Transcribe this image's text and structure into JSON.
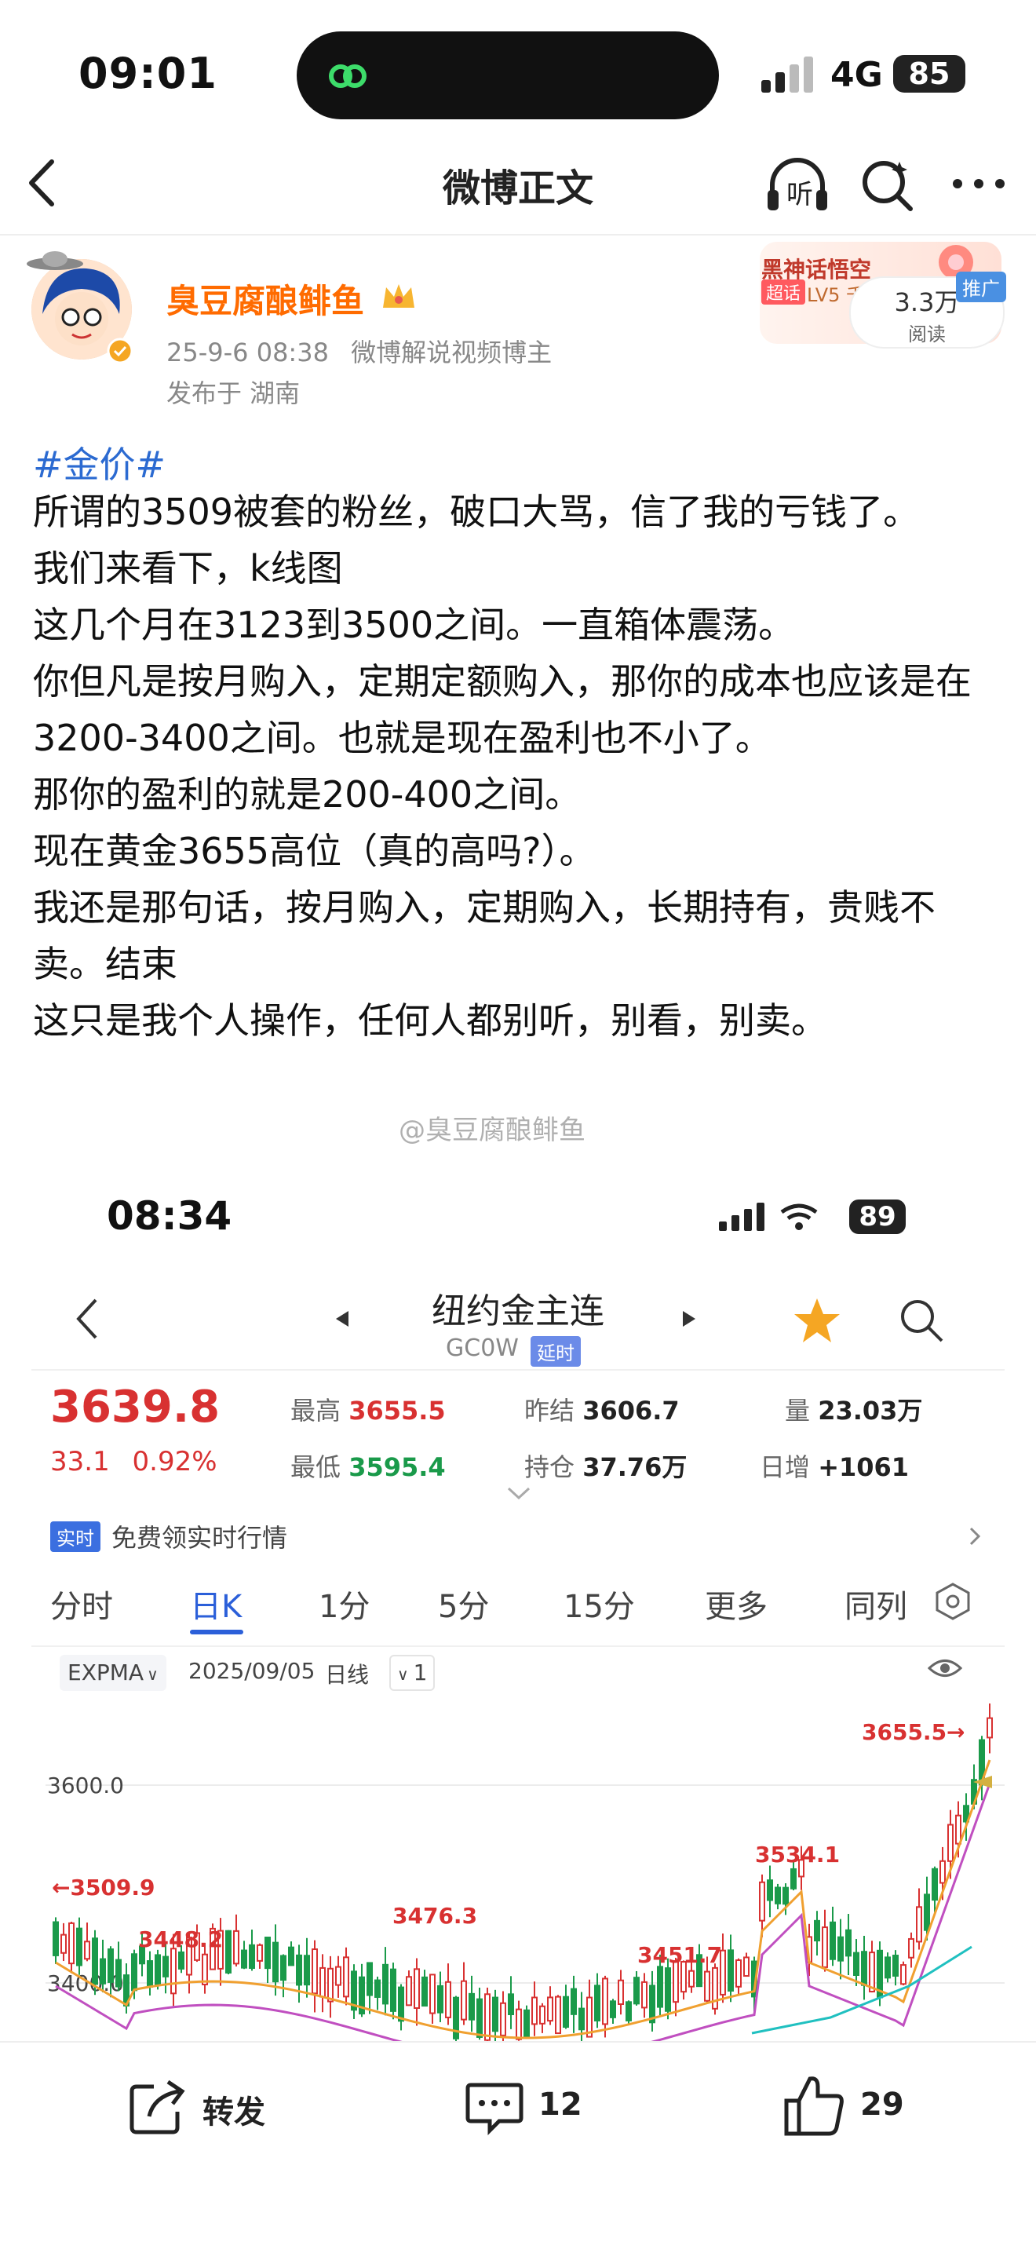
{
  "status_bar": {
    "time": "09:01",
    "network": "4G",
    "battery": "85"
  },
  "nav": {
    "title": "微博正文",
    "listen_label": "听"
  },
  "author": {
    "name": "臭豆腐酿鲱鱼",
    "date": "25-9-6 08:38",
    "description": "微博解说视频博主",
    "location": "发布于 湖南"
  },
  "promo": {
    "title": "黑神话悟空",
    "badge": "超话",
    "level": "LV5 千",
    "ad_tag": "推广"
  },
  "reads": {
    "count": "3.3万",
    "label": "阅读"
  },
  "post": {
    "topic": "#金价#",
    "lines": [
      "所谓的3509被套的粉丝，破口大骂，信了我的亏钱了。",
      "我们来看下，k线图",
      "这几个月在3123到3500之间。一直箱体震荡。",
      "你但凡是按月购入，定期定额购入，那你的成本也应该是在3200-3400之间。也就是现在盈利也不小了。",
      "那你的盈利的就是200-400之间。",
      "现在黄金3655高位（真的高吗?）。",
      "我还是那句话，按月购入，定期购入，长期持有，贵贱不卖。结束",
      "这只是我个人操作，任何人都别听，别看，别卖。"
    ],
    "watermark": "@臭豆腐酿鲱鱼"
  },
  "embedded": {
    "time": "08:34",
    "battery": "89",
    "title": "纽约金主连",
    "code": "GC0W",
    "delay_tag": "延时",
    "price": "3639.8",
    "change": "33.1",
    "change_pct": "0.92%",
    "high_label": "最高",
    "high": "3655.5",
    "low_label": "最低",
    "low": "3595.4",
    "prev_close_label": "昨结",
    "prev_close": "3606.7",
    "open_interest_label": "持仓",
    "open_interest": "37.76万",
    "volume_label": "量",
    "volume": "23.03万",
    "daily_inc_label": "日增",
    "daily_inc": "+1061",
    "realtime_tag": "实时",
    "realtime_text": "免费领实时行情",
    "tabs": [
      "分时",
      "日K",
      "1分",
      "5分",
      "15分",
      "更多",
      "同列"
    ],
    "indicator": "EXPMA",
    "date": "2025/09/05",
    "period": "日线",
    "count": "1",
    "colors": {
      "up": "#d83131",
      "down": "#1a9a4a",
      "accent": "#2b5fd9"
    }
  },
  "chart_data": {
    "type": "candlestick",
    "y_ticks": [
      "3600.0",
      "3400.0"
    ],
    "annotations": [
      "←3509.9",
      "3448.2",
      "3476.3",
      "3451.7",
      "3534.1",
      "3655.5→"
    ]
  },
  "actions": {
    "repost": "转发",
    "comments": "12",
    "likes": "29"
  }
}
